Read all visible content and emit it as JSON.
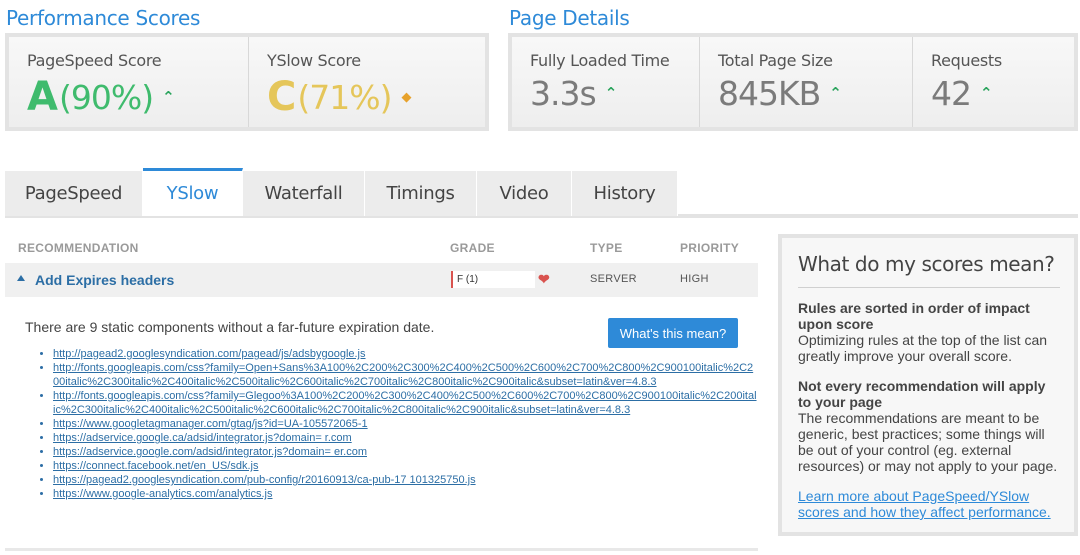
{
  "performance": {
    "title": "Performance Scores",
    "pagespeed": {
      "label": "PageSpeed Score",
      "grade": "A",
      "pct": "(90%)"
    },
    "yslow": {
      "label": "YSlow Score",
      "grade": "C",
      "pct": "(71%)"
    }
  },
  "details": {
    "title": "Page Details",
    "loaded": {
      "label": "Fully Loaded Time",
      "value": "3.3s"
    },
    "size": {
      "label": "Total Page Size",
      "value": "845KB"
    },
    "requests": {
      "label": "Requests",
      "value": "42"
    }
  },
  "tabs": [
    "PageSpeed",
    "YSlow",
    "Waterfall",
    "Timings",
    "Video",
    "History"
  ],
  "table": {
    "headers": {
      "recommendation": "RECOMMENDATION",
      "grade": "GRADE",
      "type": "TYPE",
      "priority": "PRIORITY"
    },
    "row": {
      "title": "Add Expires headers",
      "grade": "F (1)",
      "type": "SERVER",
      "priority": "HIGH"
    },
    "description": "There are 9 static components without a far-future expiration date.",
    "button": "What's this mean?",
    "links": [
      "http://pagead2.googlesyndication.com/pagead/js/adsbygoogle.js",
      "http://fonts.googleapis.com/css?family=Open+Sans%3A100%2C200%2C300%2C400%2C500%2C600%2C700%2C800%2C900100italic%2C200italic%2C300italic%2C400italic%2C500italic%2C600italic%2C700italic%2C800italic%2C900italic&subset=latin&ver=4.8.3",
      "http://fonts.googleapis.com/css?family=Glegoo%3A100%2C200%2C300%2C400%2C500%2C600%2C700%2C800%2C900100italic%2C200italic%2C300italic%2C400italic%2C500italic%2C600italic%2C700italic%2C800italic%2C900italic&subset=latin&ver=4.8.3",
      "https://www.googletagmanager.com/gtag/js?id=UA-105572065-1",
      "https://adservice.google.ca/adsid/integrator.js?domain=            r.com",
      "https://adservice.google.com/adsid/integrator.js?domain=            er.com",
      "https://connect.facebook.net/en_US/sdk.js",
      "https://pagead2.googlesyndication.com/pub-config/r20160913/ca-pub-17       101325750.js",
      "https://www.google-analytics.com/analytics.js"
    ]
  },
  "sidebar": {
    "title": "What do my scores mean?",
    "h1": "Rules are sorted in order of impact upon score",
    "p1": "Optimizing rules at the top of the list can greatly improve your overall score.",
    "h2": "Not every recommendation will apply to your page",
    "p2": "The recommendations are meant to be generic, best practices; some things will be out of your control (eg. external resources) or may not apply to your page.",
    "link": "Learn more about PageSpeed/YSlow scores and how they affect performance."
  },
  "colors": {
    "accent": "#2e8ad8",
    "grade_a": "#3fbb6d",
    "grade_c": "#e5c65a",
    "grade_f": "#d9534f"
  },
  "icons": {
    "up": "chevron-up-icon",
    "neutral": "diamond-icon",
    "expanded": "caret-up-icon",
    "grade_heart": "chevron-down-icon"
  }
}
